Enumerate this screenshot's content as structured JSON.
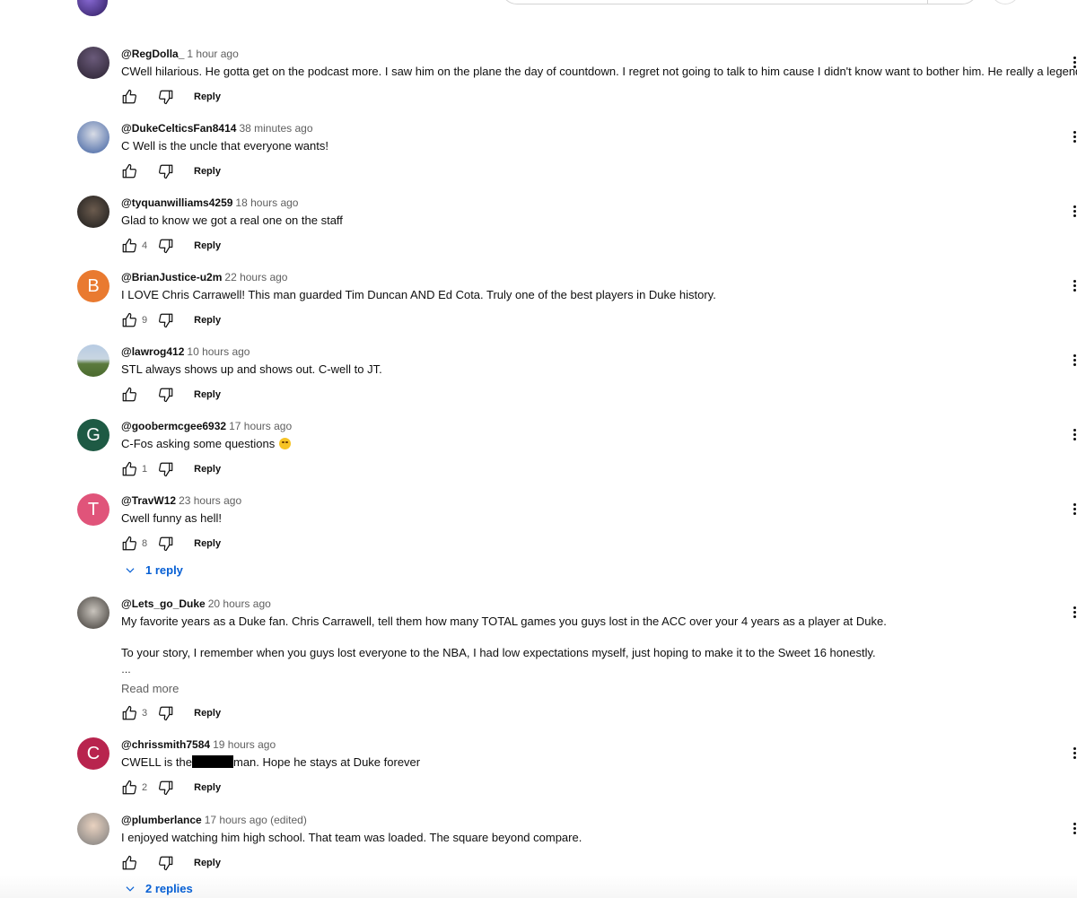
{
  "comments": [
    {
      "author": "@RegDolla_",
      "time": "1 hour ago",
      "text": "CWell hilarious. He gotta get on the podcast more. I saw him on the plane the day of countdown. I regret not going to talk to him cause I didn't know want to bother him. He really a legend",
      "likes": "",
      "reply": "Reply"
    },
    {
      "author": "@DukeCelticsFan8414",
      "time": "38 minutes ago",
      "text": "C Well is the uncle that everyone wants!",
      "likes": "",
      "reply": "Reply"
    },
    {
      "author": "@tyquanwilliams4259",
      "time": "18 hours ago",
      "text": "Glad to know we got a real one on the staff",
      "likes": "4",
      "reply": "Reply"
    },
    {
      "author": "@BrianJustice-u2m",
      "time": "22 hours ago",
      "text": "I LOVE Chris Carrawell! This man guarded Tim Duncan AND Ed Cota. Truly one of the best players in Duke history.",
      "likes": "9",
      "reply": "Reply",
      "initial": "B",
      "avatar_color": "#e97a30"
    },
    {
      "author": "@lawrog412",
      "time": "10 hours ago",
      "text": "STL always shows up and shows out. C-well to JT.",
      "likes": "",
      "reply": "Reply"
    },
    {
      "author": "@goobermcgee6932",
      "time": "17 hours ago",
      "text": "C-Fos asking some questions",
      "likes": "1",
      "reply": "Reply",
      "initial": "G",
      "avatar_color": "#1e5a44"
    },
    {
      "author": "@TravW12",
      "time": "23 hours ago",
      "text": "Cwell funny as hell!",
      "likes": "8",
      "reply": "Reply",
      "initial": "T",
      "avatar_color": "#e0547a",
      "replies": "1 reply"
    },
    {
      "author": "@Lets_go_Duke",
      "time": "20 hours ago",
      "text": "My favorite years as a Duke fan.  Chris Carrawell, tell them how many TOTAL games you guys lost in the ACC over your 4 years as a player at Duke.",
      "text2": "To your story, I remember when you guys lost everyone to the NBA, I had low expectations myself, just hoping to make it to the Sweet 16 honestly.",
      "ellipsis": "…",
      "read_more": "Read more",
      "likes": "3",
      "reply": "Reply"
    },
    {
      "author": "@chrissmith7584",
      "time": "19 hours ago",
      "text_a": "CWELL is the",
      "text_b": "man. Hope he stays at Duke forever",
      "likes": "2",
      "reply": "Reply",
      "initial": "C",
      "avatar_color": "#b8244e"
    },
    {
      "author": "@plumberlance",
      "time": "17 hours ago (edited)",
      "text": "I enjoyed watching him high school.  That team was loaded.  The square beyond compare.",
      "likes": "",
      "reply": "Reply",
      "replies": "2 replies"
    }
  ],
  "colors": {
    "link": "#065fd4",
    "meta": "#606060"
  }
}
